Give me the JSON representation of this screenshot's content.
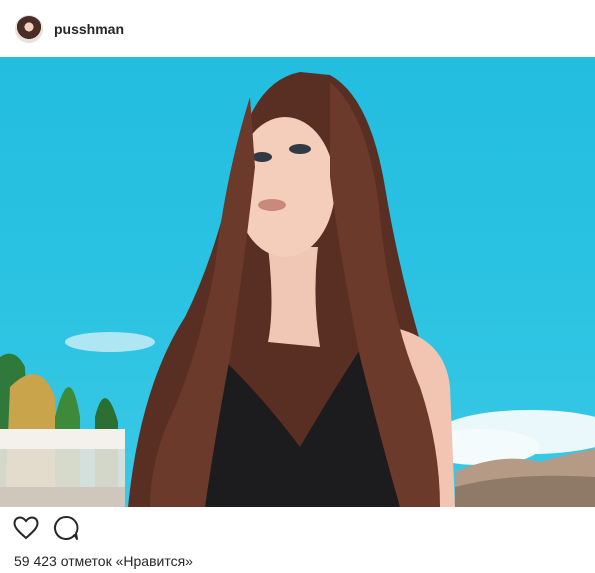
{
  "post": {
    "username": "pusshman",
    "likes_text": "59 423 отметок «Нравится»"
  },
  "icons": {
    "like": "heart-icon",
    "comment": "comment-bubble-icon"
  },
  "colors": {
    "sky": "#2cc3e2",
    "text": "#262626"
  }
}
